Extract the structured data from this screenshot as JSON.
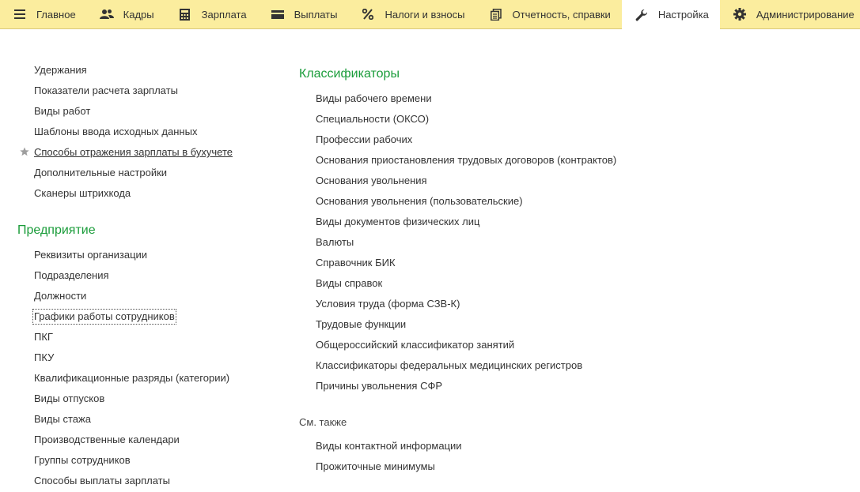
{
  "menu": {
    "tabs": [
      {
        "label": "Главное",
        "icon": "hamburger-icon"
      },
      {
        "label": "Кадры",
        "icon": "users-icon"
      },
      {
        "label": "Зарплата",
        "icon": "calculator-icon"
      },
      {
        "label": "Выплаты",
        "icon": "wallet-icon"
      },
      {
        "label": "Налоги и взносы",
        "icon": "percent-icon"
      },
      {
        "label": "Отчетность, справки",
        "icon": "documents-icon"
      },
      {
        "label": "Настройка",
        "icon": "wrench-icon",
        "active": true
      },
      {
        "label": "Администрирование",
        "icon": "gear-icon"
      }
    ]
  },
  "left": {
    "top_links": [
      "Удержания",
      "Показатели расчета зарплаты",
      "Виды работ",
      "Шаблоны ввода исходных данных",
      "Способы отражения зарплаты в бухучете",
      "Дополнительные настройки",
      "Сканеры штрихкода"
    ],
    "enterprise_title": "Предприятие",
    "enterprise_links": [
      "Реквизиты организации",
      "Подразделения",
      "Должности",
      "Графики работы сотрудников",
      "ПКГ",
      "ПКУ",
      "Квалификационные разряды (категории)",
      "Виды отпусков",
      "Виды стажа",
      "Производственные календари",
      "Группы сотрудников",
      "Способы выплаты зарплаты"
    ]
  },
  "right": {
    "classifiers_title": "Классификаторы",
    "classifier_links": [
      "Виды рабочего времени",
      "Специальности (ОКСО)",
      "Профессии рабочих",
      "Основания приостановления трудовых договоров (контрактов)",
      "Основания увольнения",
      "Основания увольнения (пользовательские)",
      "Виды документов физических лиц",
      "Валюты",
      "Справочник БИК",
      "Виды справок",
      "Условия труда (форма СЗВ-К)",
      "Трудовые функции",
      "Общероссийский классификатор занятий",
      "Классификаторы федеральных медицинских регистров",
      "Причины увольнения СФР"
    ],
    "see_also_title": "См. также",
    "see_also_links": [
      "Виды контактной информации",
      "Прожиточные минимумы"
    ]
  },
  "colors": {
    "menu_bg": "#fbed9e",
    "section_title": "#1a9c3a",
    "text": "#333333"
  }
}
